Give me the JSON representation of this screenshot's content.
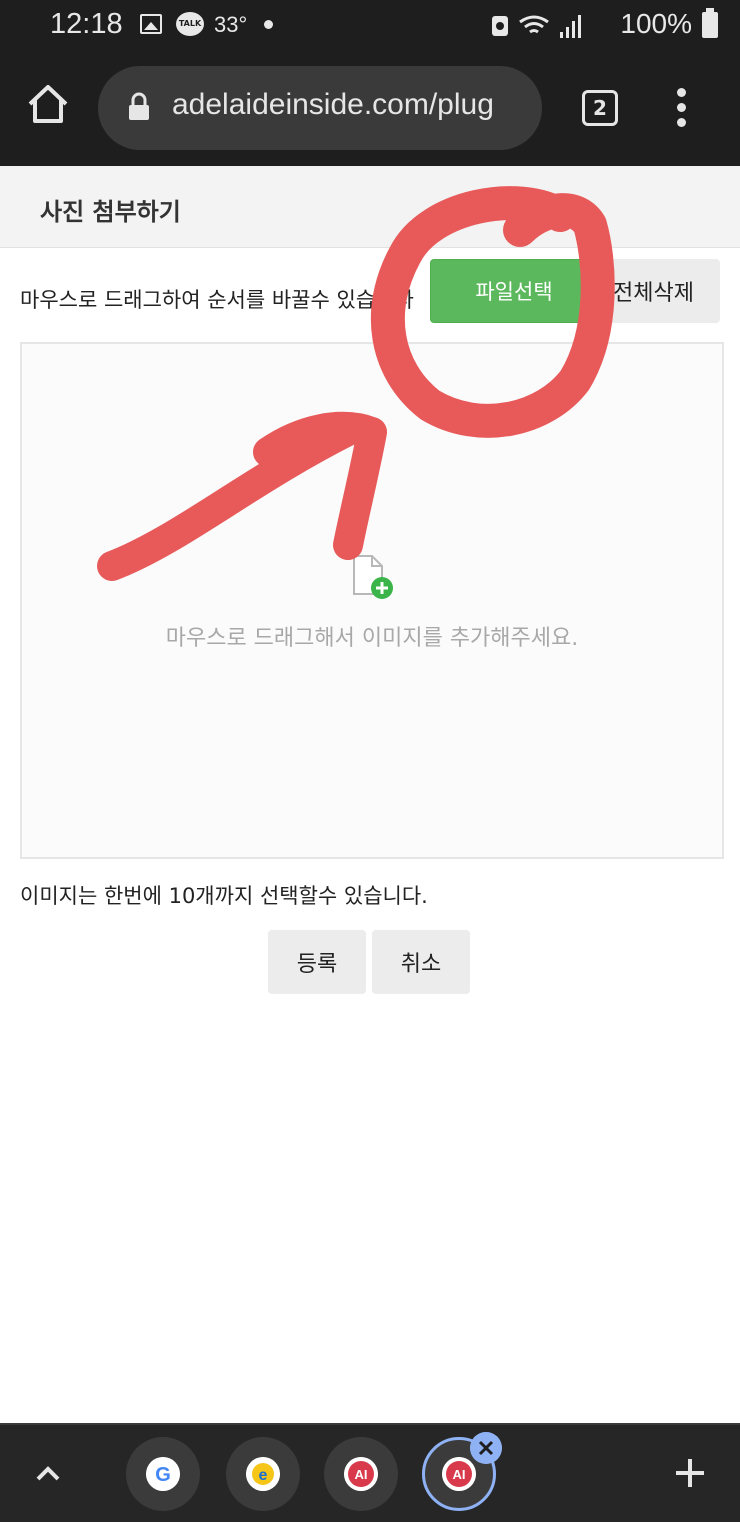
{
  "status_bar": {
    "time": "12:18",
    "temperature": "33°",
    "battery": "100%",
    "icons": [
      "gallery-icon",
      "kakaotalk-icon",
      "dot-icon",
      "wifi-icon",
      "signal-icon",
      "battery-icon"
    ]
  },
  "browser": {
    "url": "adelaideinside.com/plug",
    "tab_count": "2"
  },
  "page": {
    "title": "사진 첨부하기",
    "drag_hint": "마우스로 드래그하여 순서를 바꿀수 있습니다",
    "file_select_button": "파일선택",
    "delete_all_button": "전체삭제",
    "dropzone_text": "마우스로 드래그해서 이미지를 추가해주세요.",
    "limit_info": "이미지는 한번에 10개까지 선택할수 있습니다.",
    "register_button": "등록",
    "cancel_button": "취소"
  },
  "annotation": {
    "color": "#e85a5a",
    "shapes": [
      "circle around 파일선택",
      "arrow pointing to 파일선택"
    ]
  },
  "tab_strip": {
    "tabs": [
      {
        "favicon": "google-icon"
      },
      {
        "favicon": "ie-icon"
      },
      {
        "favicon": "ai-icon"
      },
      {
        "favicon": "ai-icon",
        "active": true
      }
    ]
  }
}
